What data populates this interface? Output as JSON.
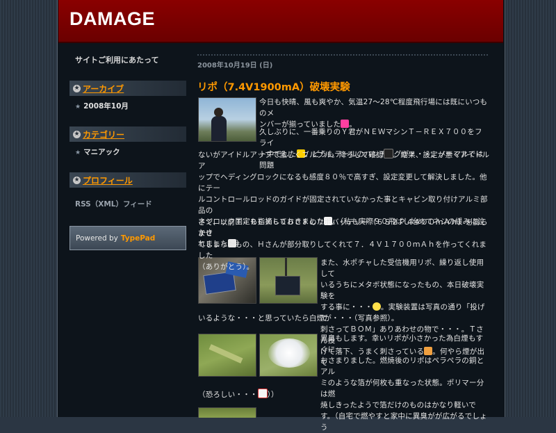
{
  "site": {
    "title": "DAMAGE"
  },
  "sidebar": {
    "top_link": "サイトご利用にあたって",
    "sections": [
      {
        "heading": "アーカイブ",
        "items": [
          "2008年10月"
        ]
      },
      {
        "heading": "カテゴリー",
        "items": [
          "マニアック"
        ]
      },
      {
        "heading": "プロフィール",
        "items": []
      }
    ],
    "rss": "RSS（XML）フィード",
    "powered_by": {
      "prefix": "Powered by",
      "brand": "TypePad"
    }
  },
  "post": {
    "date": "2008年10月19日 (日)",
    "title": "リポ（7.4V1900mA）破壊実験",
    "p1_l1": "今日も快晴、風も爽やか、気温27〜28℃程度飛行場には既にいつものメ",
    "p1_l2": "ンバーが揃っていました",
    "p2_l1": "久しぶりに、一番乗りのＹ君がＮＥＷマシンＴ－ＲＥＸ７００をフライ",
    "p2_l2": "ト中でした",
    "p2_l2b": "。どうもテールのハンチングが・・・。ノーマルでは問題",
    "p2_l3": "ないがアイドルアップで激しくブルブル。降ろして確認",
    "p2_l3b": "。結果、設定が悪くアイドルア",
    "p2_l4": "ップでヘディングロックになるも感度８０％で高すぎ、設定変更して解決しました。他にテー",
    "p2_l5": "ルコントロールロッドのガイドが固定されていなかった事とキャビン取り付けアルミ部品の",
    "p2_l6": "ネジロック固定も指摘しておきました",
    "p2_l6b": "。（私も実際９０飛ばし始めてネジの緩みに泣かさ",
    "p2_l7": "れました",
    "p2_l7b": "）",
    "p3_l1": "さて、以前Ｔ－ＲＥＸ６００ＣＦのリポバッテリー（６Ｓ２Ｐ４４００ｍＡｈ）を膨らませ",
    "p3_l2": "てしまったもの、Ｈさんが部分取りしてくれて７．４Ｖ１７００ｍＡｈを作ってくれました",
    "p3_l3": "（ありがとう）。",
    "p4_l1": "また、水ポチャした受信機用リポ、繰り返し使用して",
    "p4_l2": "いるうちにメタボ状態になったもの、本日破壊実験を",
    "p4_l3": "する事に・・・",
    "p4_l3b": "。実験装置は写真の通り「投げて",
    "p4_l4": "刺さってＢＯＭ」ありあわせの物で・・・。Ｔさん投",
    "p4_l5": "げて落下、うまく刺さっている",
    "p4_l5b": "。何やら煙が出て",
    "p4_l6": "いるような・・・と思っていたら白煙が・・・（写真参照）。",
    "p5_l1": "異臭もします。幸いリポが小さかった為白煙もすぐに",
    "p5_l2": "おさまりました。燃焼後のリポはペラペラの銅とアル",
    "p5_l3": "ミのような箔が何枚も重なった状態。ポリマー分は燃",
    "p5_l4": "焼しきったようで箔だけのものはかなり軽いで",
    "p5_l5": "す。（自宅で燃やすと家中に異臭がが広がるでしょう",
    "p5_l6": "（恐ろしい・・・",
    "p5_l6b": "））"
  },
  "colors": {
    "accent": "#ff9900",
    "banner": "#7a0000",
    "content_bg": "#0d141b"
  }
}
